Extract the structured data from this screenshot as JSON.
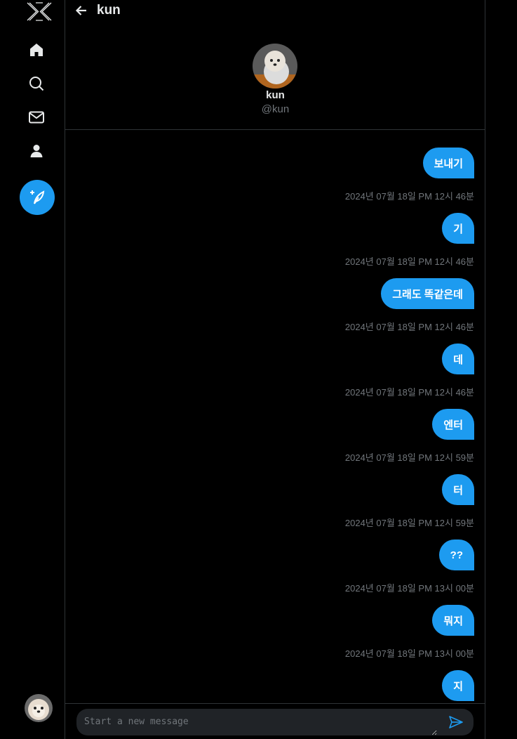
{
  "header": {
    "title": "kun"
  },
  "profile": {
    "name": "kun",
    "handle": "@kun"
  },
  "messages": [
    {
      "text": "보내기",
      "time": "2024년 07월 18일 PM 12시 46분"
    },
    {
      "text": "기",
      "time": "2024년 07월 18일 PM 12시 46분"
    },
    {
      "text": "그래도 똑같은데",
      "time": "2024년 07월 18일 PM 12시 46분"
    },
    {
      "text": "데",
      "time": "2024년 07월 18일 PM 12시 46분"
    },
    {
      "text": "엔터",
      "time": "2024년 07월 18일 PM 12시 59분"
    },
    {
      "text": "터",
      "time": "2024년 07월 18일 PM 12시 59분"
    },
    {
      "text": "??",
      "time": "2024년 07월 18일 PM 13시 00분"
    },
    {
      "text": "뭐지",
      "time": "2024년 07월 18일 PM 13시 00분"
    },
    {
      "text": "지",
      "time": ""
    }
  ],
  "composer": {
    "placeholder": "Start a new message"
  },
  "colors": {
    "accent": "#1d9bf0",
    "background": "#000000",
    "muted": "#71767b"
  },
  "icons": [
    "logo-x",
    "home-icon",
    "search-icon",
    "mail-icon",
    "profile-icon",
    "compose-feather-icon",
    "back-arrow-icon",
    "send-icon"
  ]
}
